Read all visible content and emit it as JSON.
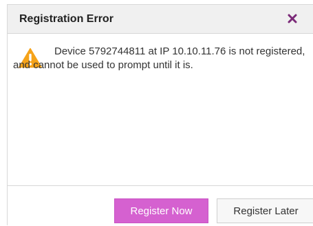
{
  "dialog": {
    "title": "Registration Error",
    "close_icon": "close-icon",
    "warning_icon": "warning-icon",
    "message": "Device 5792744811 at IP 10.10.11.76 is not registered, and cannot be used to prompt until it is.",
    "buttons": {
      "primary_label": "Register Now",
      "secondary_label": "Register Later"
    }
  },
  "colors": {
    "accent": "#d561d0",
    "close_icon": "#7b2a78",
    "warning": "#f5a31a"
  }
}
